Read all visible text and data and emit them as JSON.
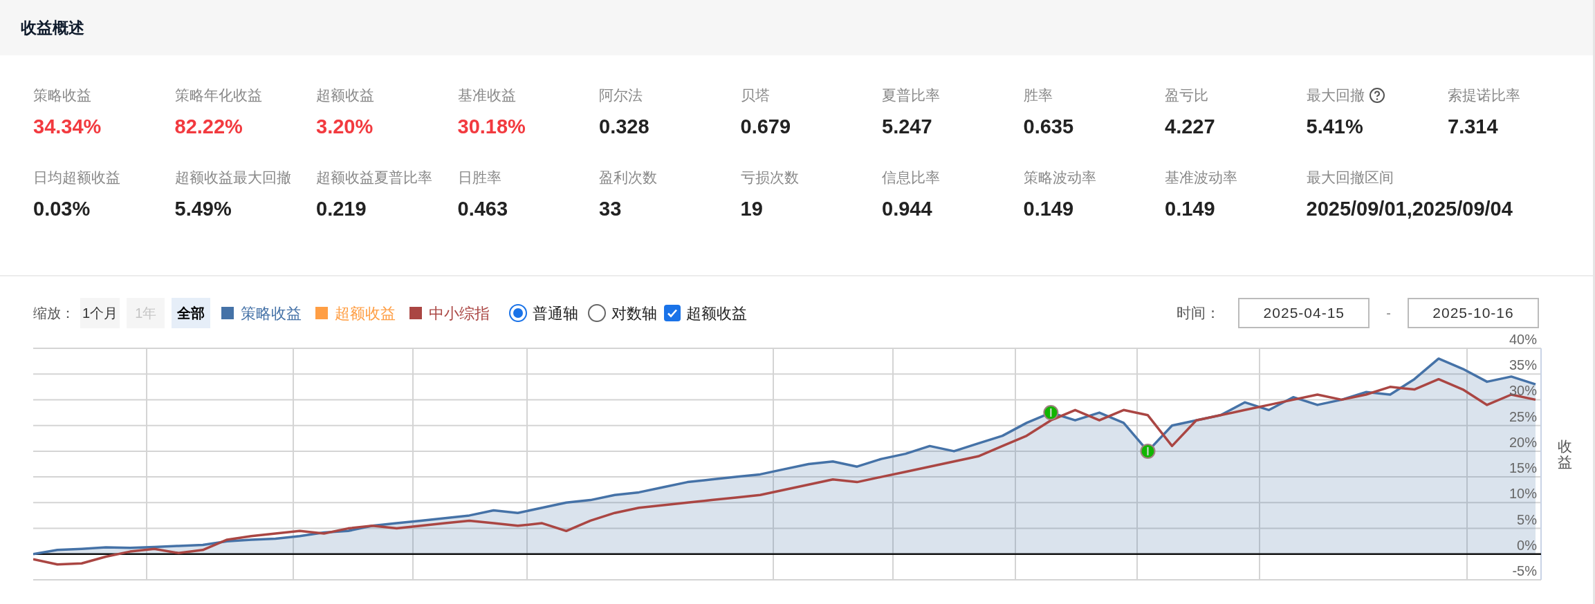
{
  "panel": {
    "title": "收益概述"
  },
  "metrics": [
    {
      "label": "策略收益",
      "value": "34.34%",
      "highlight": true,
      "help": false
    },
    {
      "label": "策略年化收益",
      "value": "82.22%",
      "highlight": true,
      "help": false
    },
    {
      "label": "超额收益",
      "value": "3.20%",
      "highlight": true,
      "help": false
    },
    {
      "label": "基准收益",
      "value": "30.18%",
      "highlight": true,
      "help": false
    },
    {
      "label": "阿尔法",
      "value": "0.328",
      "highlight": false,
      "help": false
    },
    {
      "label": "贝塔",
      "value": "0.679",
      "highlight": false,
      "help": false
    },
    {
      "label": "夏普比率",
      "value": "5.247",
      "highlight": false,
      "help": false
    },
    {
      "label": "胜率",
      "value": "0.635",
      "highlight": false,
      "help": false
    },
    {
      "label": "盈亏比",
      "value": "4.227",
      "highlight": false,
      "help": false
    },
    {
      "label": "最大回撤",
      "value": "5.41%",
      "highlight": false,
      "help": true
    },
    {
      "label": "索提诺比率",
      "value": "7.314",
      "highlight": false,
      "help": false
    },
    {
      "label": "日均超额收益",
      "value": "0.03%",
      "highlight": false,
      "help": false
    },
    {
      "label": "超额收益最大回撤",
      "value": "5.49%",
      "highlight": false,
      "help": false
    },
    {
      "label": "超额收益夏普比率",
      "value": "0.219",
      "highlight": false,
      "help": false
    },
    {
      "label": "日胜率",
      "value": "0.463",
      "highlight": false,
      "help": false
    },
    {
      "label": "盈利次数",
      "value": "33",
      "highlight": false,
      "help": false
    },
    {
      "label": "亏损次数",
      "value": "19",
      "highlight": false,
      "help": false
    },
    {
      "label": "信息比率",
      "value": "0.944",
      "highlight": false,
      "help": false
    },
    {
      "label": "策略波动率",
      "value": "0.149",
      "highlight": false,
      "help": false
    },
    {
      "label": "基准波动率",
      "value": "0.149",
      "highlight": false,
      "help": false
    },
    {
      "label": "最大回撤区间",
      "value": "2025/09/01,2025/09/04",
      "highlight": false,
      "help": false
    }
  ],
  "toolbar": {
    "zoom_label": "缩放：",
    "zoom_buttons": [
      {
        "label": "1个月",
        "selected": false,
        "disabled": false
      },
      {
        "label": "1年",
        "selected": false,
        "disabled": true
      },
      {
        "label": "全部",
        "selected": true,
        "disabled": false
      }
    ],
    "legend_extra": {
      "label": "超额收益",
      "color": "#ff9e44"
    },
    "axis_options": [
      {
        "label": "普通轴",
        "selected": true
      },
      {
        "label": "对数轴",
        "selected": false
      }
    ],
    "excess_toggle": {
      "label": "超额收益",
      "checked": true
    },
    "time_label": "时间：",
    "start_date": "2025-04-15",
    "separator": "-",
    "end_date": "2025-10-16"
  },
  "chart": {
    "chart_data": {
      "type": "line",
      "ylabel": "收益",
      "ylim": [
        -5,
        40
      ],
      "grid": true,
      "yticks": [
        {
          "value": 40,
          "label": "40%"
        },
        {
          "value": 35,
          "label": "35%"
        },
        {
          "value": 30,
          "label": "30%"
        },
        {
          "value": 25,
          "label": "25%"
        },
        {
          "value": 20,
          "label": "20%"
        },
        {
          "value": 15,
          "label": "15%"
        },
        {
          "value": 10,
          "label": "10%"
        },
        {
          "value": 5,
          "label": "5%"
        },
        {
          "value": 0,
          "label": "0%"
        },
        {
          "value": -5,
          "label": "-5%"
        }
      ],
      "series": [
        {
          "name": "策略收益",
          "color": "#4572a7",
          "values": [
            0,
            0.8,
            1,
            1.3,
            1.2,
            1.4,
            1.6,
            1.8,
            2.5,
            2.8,
            3,
            3.5,
            4.2,
            4.5,
            5.5,
            6,
            6.5,
            7,
            7.5,
            8.5,
            8,
            9,
            10,
            10.5,
            11.5,
            12,
            13,
            14,
            14.5,
            15,
            15.5,
            16.5,
            17.5,
            18,
            17,
            18.5,
            19.5,
            21,
            20,
            21.5,
            23,
            25.5,
            27.5,
            26,
            27.5,
            25.5,
            20,
            25,
            26,
            27,
            29.5,
            28,
            30.5,
            29,
            30,
            31.5,
            31,
            34,
            38,
            36,
            33.5,
            34.5,
            33
          ]
        },
        {
          "name": "中小综指",
          "color": "#aa4643",
          "values": [
            -1,
            -2,
            -1.8,
            -0.5,
            0.5,
            1,
            0.2,
            0.8,
            2.8,
            3.5,
            4,
            4.5,
            4,
            5,
            5.5,
            5,
            5.5,
            6,
            6.5,
            6,
            5.5,
            6,
            4.5,
            6.5,
            8,
            9,
            9.5,
            10,
            10.5,
            11,
            11.5,
            12.5,
            13.5,
            14.5,
            14,
            15,
            16,
            17,
            18,
            19,
            21,
            23,
            26,
            28,
            26,
            28,
            27,
            21,
            26,
            27,
            28,
            29,
            30,
            31,
            30,
            31,
            32.5,
            32,
            34,
            32,
            29,
            31,
            30
          ]
        }
      ]
    }
  }
}
